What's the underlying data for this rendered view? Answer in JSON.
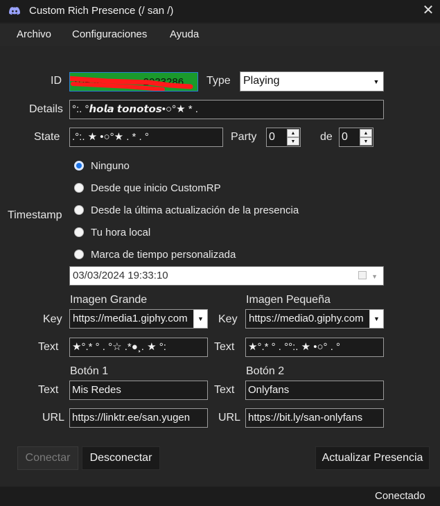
{
  "window": {
    "title": "Custom Rich Presence (/ san /)",
    "close_glyph": "✕",
    "icon": "discord-icon"
  },
  "menu": {
    "items": [
      "Archivo",
      "Configuraciones",
      "Ayuda"
    ]
  },
  "form": {
    "id_label": "ID",
    "id_value": "1095•••••••••••••2033286",
    "type_label": "Type",
    "type_value": "Playing",
    "details_label": "Details",
    "details_value": "°:. °𝙝𝙤𝙡𝙖 𝙩𝙤𝙣𝙤𝙩𝙤𝙨•○°★ * .",
    "state_label": "State",
    "state_value": ".°:. ★ •○°★ . * . °",
    "party_label": "Party",
    "party_value": "0",
    "party_of_label": "de",
    "party_max_value": "0"
  },
  "timestamp": {
    "label": "Timestamp",
    "options": [
      "Ninguno",
      "Desde que inicio CustomRP",
      "Desde la última actualización de la presencia",
      "Tu hora local",
      "Marca de tiempo personalizada"
    ],
    "selected_index": 0,
    "datetime_value": "03/03/2024 19:33:10"
  },
  "images": {
    "large": {
      "heading": "Imagen Grande",
      "key_label": "Key",
      "key_value": "https://media1.giphy.com",
      "text_label": "Text",
      "text_value": "★°.* ° . °☆ .*●¸. ★ °:"
    },
    "small": {
      "heading": "Imagen Pequeña",
      "key_label": "Key",
      "key_value": "https://media0.giphy.com",
      "text_label": "Text",
      "text_value": "★°.* ° . °°:. ★ •○° . °"
    }
  },
  "buttons": {
    "b1": {
      "heading": "Botón 1",
      "text_label": "Text",
      "text_value": "Mis Redes",
      "url_label": "URL",
      "url_value": "https://linktr.ee/san.yugen"
    },
    "b2": {
      "heading": "Botón 2",
      "text_label": "Text",
      "text_value": "Onlyfans",
      "url_label": "URL",
      "url_value": "https://bit.ly/san-onlyfans"
    }
  },
  "actions": {
    "connect": "Conectar",
    "disconnect": "Desconectar",
    "update": "Actualizar Presencia"
  },
  "status": {
    "text": "Conectado"
  },
  "colors": {
    "accent": "#1a73e8",
    "id_field_bg": "#1a9a2c",
    "redaction": "#ff1a1a"
  }
}
